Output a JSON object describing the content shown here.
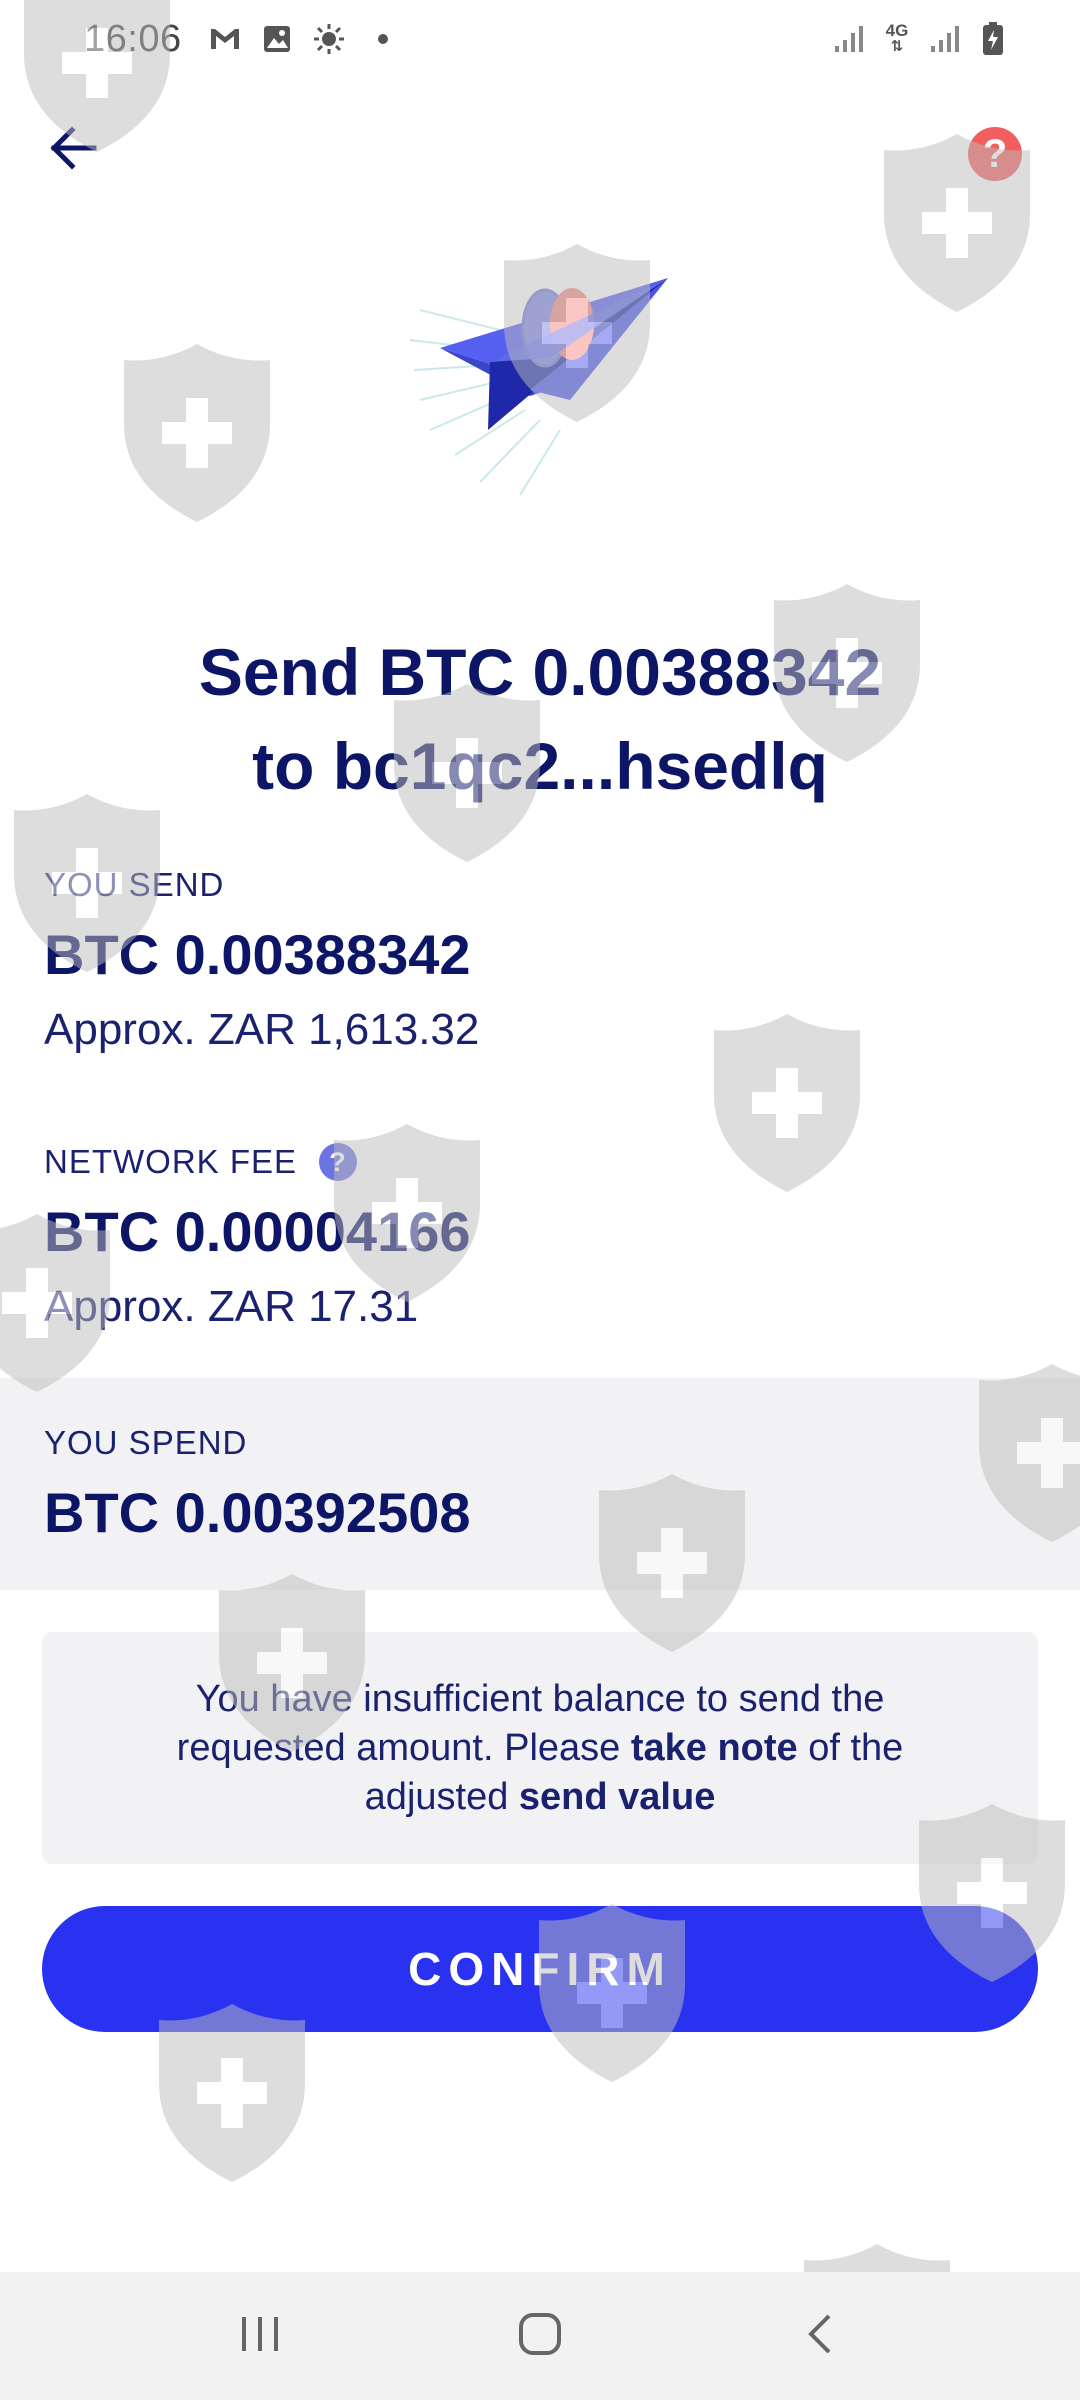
{
  "status_bar": {
    "time": "16:06",
    "left_icons": [
      "gmail-icon",
      "gallery-icon",
      "brightness-icon"
    ],
    "network": "4G",
    "right_icons": [
      "signal-icon",
      "4g-data-icon",
      "signal-icon",
      "battery-charging-icon"
    ]
  },
  "header": {
    "back_icon": "arrow-left-icon",
    "help_label": "?"
  },
  "hero": {
    "illustration": "paper-plane-with-coin"
  },
  "title": {
    "line1": "Send BTC 0.00388342",
    "line2": "to bc1qc2...hsedlq"
  },
  "you_send": {
    "label": "YOU SEND",
    "amount": "BTC 0.00388342",
    "approx": "Approx. ZAR 1,613.32"
  },
  "network_fee": {
    "label": "NETWORK FEE",
    "info_label": "?",
    "amount": "BTC 0.00004166",
    "approx": "Approx. ZAR 17.31"
  },
  "you_spend": {
    "label": "YOU SPEND",
    "amount": "BTC 0.00392508"
  },
  "notice": {
    "part1": "You have insufficient balance to send the requested amount. Please ",
    "bold1": "take note",
    "part2": " of the adjusted ",
    "bold2": "send value"
  },
  "confirm": {
    "label": "CONFIRM"
  },
  "nav_bar": {
    "icons": [
      "recent-apps-icon",
      "home-icon",
      "back-nav-icon"
    ]
  },
  "colors": {
    "primary_text": "#0d1566",
    "accent_blue": "#2832f0",
    "help_red": "#f25d5d",
    "info_purple": "#6d73e3",
    "panel_grey": "#f2f2f4"
  }
}
